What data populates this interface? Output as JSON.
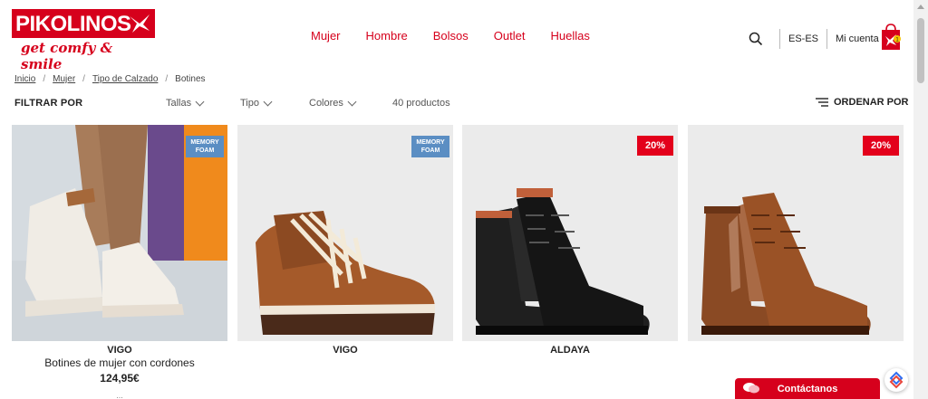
{
  "brand": {
    "name": "PIKOLINOS",
    "tagline": "get comfy & smile",
    "color": "#d6001c"
  },
  "nav": {
    "items": [
      "Mujer",
      "Hombre",
      "Bolsos",
      "Outlet",
      "Huellas"
    ]
  },
  "utility": {
    "search_icon": "search-icon",
    "language": "ES-ES",
    "account": "Mi cuenta",
    "bag_count": "1"
  },
  "breadcrumb": [
    "Inicio",
    "Mujer",
    "Tipo de Calzado",
    "Botines"
  ],
  "filters": {
    "label": "FILTRAR POR",
    "dropdowns": [
      "Tallas",
      "Tipo",
      "Colores"
    ],
    "count": "40 productos",
    "sort": "ORDENAR POR"
  },
  "products": [
    {
      "name": "VIGO",
      "desc": "Botines de mujer con cordones",
      "price": "124,95€",
      "extra": "...",
      "badge": "MEMORY FOAM"
    },
    {
      "name": "VIGO",
      "badge": "MEMORY FOAM"
    },
    {
      "name": "ALDAYA",
      "badge": "20%"
    },
    {
      "badge": "20%"
    }
  ],
  "contact": {
    "label": "Contáctanos"
  }
}
